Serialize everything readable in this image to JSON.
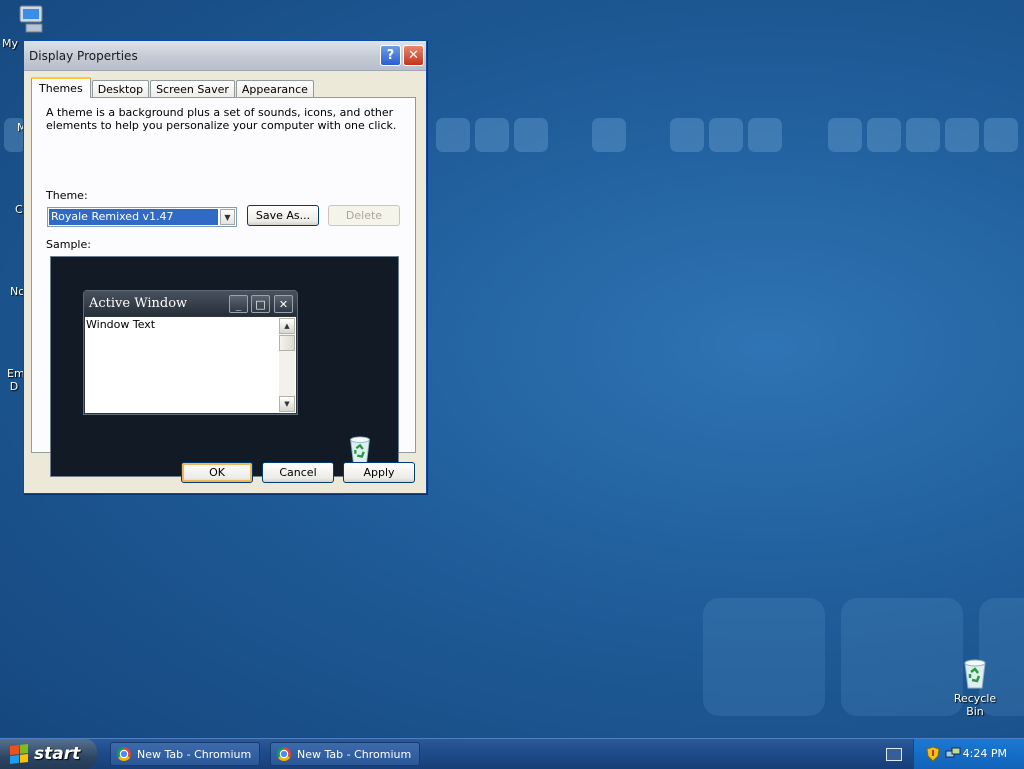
{
  "desktop": {
    "icons": [
      {
        "name": "my-computer-icon",
        "label": "My"
      },
      {
        "name": "partial-icon-m",
        "label": "M"
      },
      {
        "name": "partial-icon-c",
        "label": "C"
      },
      {
        "name": "partial-icon-nc",
        "label": "Nc"
      },
      {
        "name": "partial-icon-em",
        "label": "Em D"
      }
    ],
    "recycle_bin": {
      "label": "Recycle Bin",
      "icon": "recycle-bin-icon"
    }
  },
  "dialog": {
    "title": "Display Properties",
    "help_glyph": "?",
    "close_glyph": "✕",
    "tabs": [
      {
        "label": "Themes",
        "active": true
      },
      {
        "label": "Desktop",
        "active": false
      },
      {
        "label": "Screen Saver",
        "active": false
      },
      {
        "label": "Appearance",
        "active": false
      }
    ],
    "description": "A theme is a background plus a set of sounds, icons, and other elements to help you personalize your computer with one click.",
    "theme_label": "Theme:",
    "theme_value": "Royale Remixed v1.47",
    "save_as": "Save As...",
    "delete": "Delete",
    "sample_label": "Sample:",
    "sample_window": {
      "title": "Active Window",
      "text": "Window Text"
    },
    "buttons": {
      "ok": "OK",
      "cancel": "Cancel",
      "apply": "Apply"
    }
  },
  "taskbar": {
    "start": "start",
    "tasks": [
      {
        "label": "New Tab - Chromium"
      },
      {
        "label": "New Tab - Chromium"
      }
    ],
    "clock": "4:24 PM"
  },
  "colors": {
    "accent": "#316ac5",
    "desktop": "#1f5c99",
    "taskbar": "#1f4d8c"
  }
}
